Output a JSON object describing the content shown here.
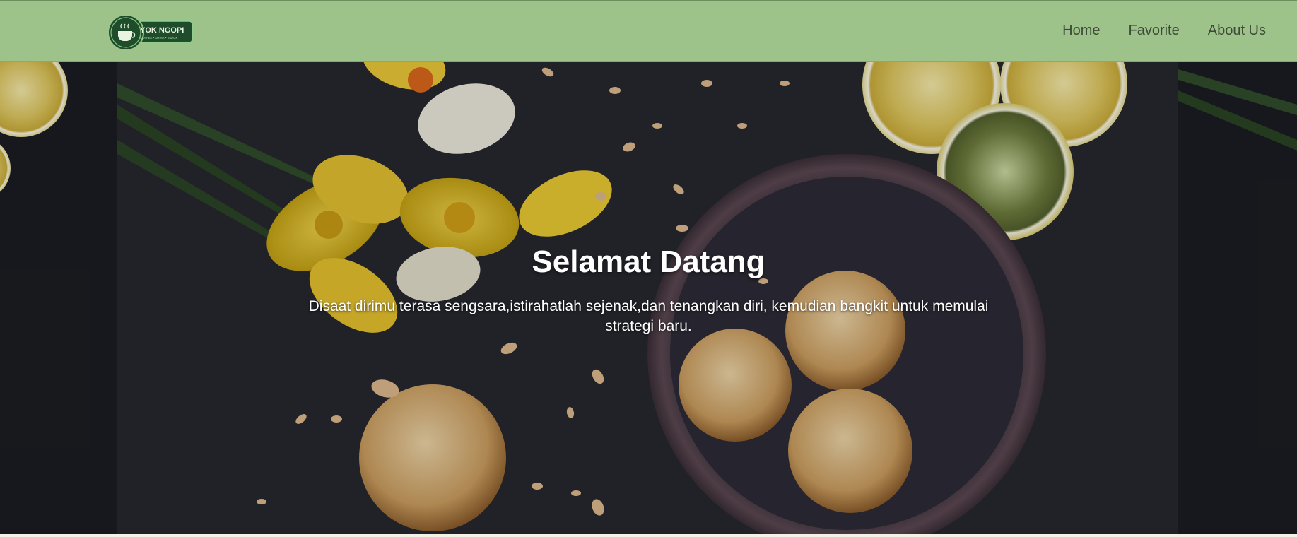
{
  "brand": {
    "logo_name": "YOK NGOPI",
    "logo_tagline": "COFFEE • DRINK • SNACK"
  },
  "nav": {
    "items": [
      {
        "label": "Home"
      },
      {
        "label": "Favorite"
      },
      {
        "label": "About Us"
      }
    ]
  },
  "hero": {
    "title": "Selamat Datang",
    "subtitle": "Disaat dirimu terasa sengsara,istirahatlah sejenak,dan tenangkan diri, kemudian bangkit untuk memulai strategi baru."
  },
  "colors": {
    "navbar": "#9dc28a",
    "logo_dark": "#1f4d2b",
    "hero_bg": "#23242a",
    "text_light": "#ffffff"
  }
}
